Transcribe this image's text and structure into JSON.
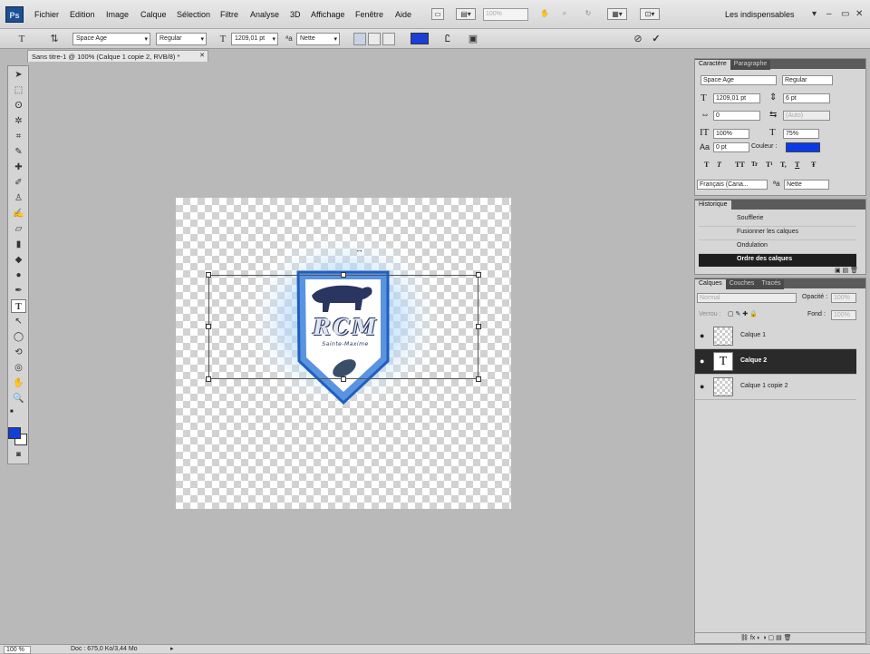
{
  "menubar": {
    "logo": "Ps",
    "items": [
      "Fichier",
      "Edition",
      "Image",
      "Calque",
      "Sélection",
      "Filtre",
      "Analyse",
      "3D",
      "Affichage",
      "Fenêtre",
      "Aide"
    ],
    "zoom": "100%",
    "workspace": "Les indispensables"
  },
  "options": {
    "font_family": "Space Age",
    "font_style": "Regular",
    "font_size": "1209,01 pt",
    "antialias": "Nette",
    "text_color": "#1a3fd8"
  },
  "document": {
    "tab_title": "Sans titre-1 @ 100% (Calque 1 copie 2, RVB/8) *",
    "logo_text": "RCM",
    "logo_subtext": "Sainte-Maxime"
  },
  "character_panel": {
    "tabs": [
      "Caractère",
      "Paragraphe"
    ],
    "font_family": "Space Age",
    "font_style": "Regular",
    "size": "1209,01 pt",
    "leading": "6 pt",
    "kerning": "0",
    "tracking": "(Auto)",
    "vertical_scale": "100%",
    "horizontal_scale": "75%",
    "baseline": "0 pt",
    "color_label": "Couleur :",
    "color": "#0b3be6",
    "language": "Français (Cana...",
    "antialias": "Nette",
    "format_buttons": [
      "T",
      "T",
      "TT",
      "Tr",
      "T¹",
      "T,",
      "T",
      "Ŧ"
    ]
  },
  "history_panel": {
    "tab": "Historique",
    "items": [
      "Soufflerie",
      "Fusionner les calques",
      "Ondulation",
      "Ordre des calques"
    ],
    "selected": "Ordre des calques"
  },
  "layers_panel": {
    "tabs": [
      "Calques",
      "Couches",
      "Tracés"
    ],
    "blend_mode": "Normal",
    "opacity_label": "Opacité :",
    "opacity": "100%",
    "lock_label": "Verrou :",
    "fill_label": "Fond :",
    "fill": "100%",
    "layers": [
      {
        "name": "Calque 1",
        "type": "raster"
      },
      {
        "name": "Calque 2",
        "type": "text",
        "thumb": "T"
      },
      {
        "name": "Calque 1 copie 2",
        "type": "raster"
      }
    ],
    "selected": "Calque 2"
  },
  "status": {
    "zoom": "100 %",
    "doc_info": "Doc : 675,0 Ko/3,44 Mo"
  },
  "colors": {
    "foreground": "#1240d6",
    "background": "#ffffff"
  }
}
